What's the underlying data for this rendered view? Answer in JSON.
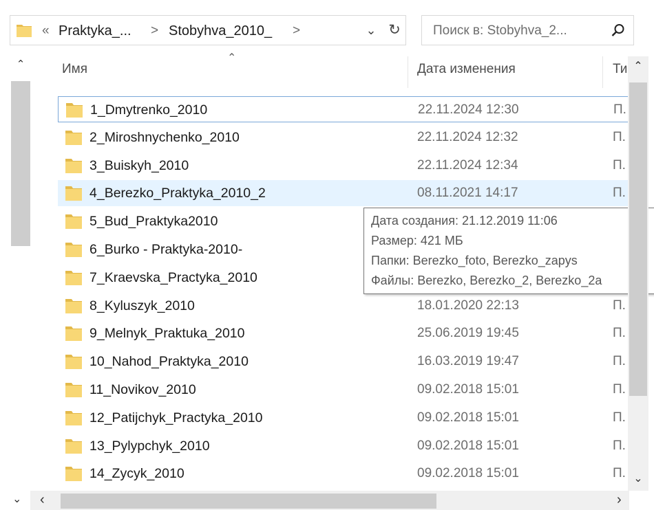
{
  "address": {
    "overflow": "«",
    "crumbs": [
      "Praktyka_...",
      "Stobyhva_2010_"
    ],
    "separators": [
      ">",
      ">",
      ">"
    ]
  },
  "search": {
    "placeholder": "Поиск в: Stobyhva_2..."
  },
  "columns": {
    "name": "Имя",
    "date": "Дата изменения",
    "type": "Ти"
  },
  "files": [
    {
      "name": "1_Dmytrenko_2010",
      "date": "22.11.2024 12:30",
      "type": "П."
    },
    {
      "name": "2_Miroshnychenko_2010",
      "date": "22.11.2024 12:32",
      "type": "П."
    },
    {
      "name": "3_Buiskyh_2010",
      "date": "22.11.2024 12:34",
      "type": "П."
    },
    {
      "name": "4_Berezko_Praktyka_2010_2",
      "date": "08.11.2021 14:17",
      "type": "П."
    },
    {
      "name": "5_Bud_Praktyka2010",
      "date": "",
      "type": ""
    },
    {
      "name": "6_Burko - Praktyka-2010-",
      "date": "",
      "type": ""
    },
    {
      "name": "7_Kraevska_Practyka_2010",
      "date": "",
      "type": ""
    },
    {
      "name": "8_Kyluszyk_2010",
      "date": "18.01.2020 22:13",
      "type": "П."
    },
    {
      "name": "9_Melnyk_Praktuka_2010",
      "date": "25.06.2019 19:45",
      "type": "П."
    },
    {
      "name": "10_Nahod_Praktyka_2010",
      "date": "16.03.2019 19:47",
      "type": "П."
    },
    {
      "name": "11_Novikov_2010",
      "date": "09.02.2018 15:01",
      "type": "П."
    },
    {
      "name": "12_Patijchyk_Practyka_2010",
      "date": "09.02.2018 15:01",
      "type": "П."
    },
    {
      "name": "13_Pylypchyk_2010",
      "date": "09.02.2018 15:01",
      "type": "П."
    },
    {
      "name": "14_Zycyk_2010",
      "date": "09.02.2018 15:01",
      "type": "П."
    }
  ],
  "tooltip": {
    "created": "Дата создания: 21.12.2019 11:06",
    "size": "Размер: 421 МБ",
    "folders": "Папки: Berezko_foto, Berezko_zapys",
    "files": "Файлы: Berezko, Berezko_2, Berezko_2a"
  },
  "colors": {
    "folder": "#f8d775",
    "folder_dark": "#e3b94a",
    "hover_row": "#e5f3ff",
    "focus_outline": "#7aa7d8"
  },
  "icons": {
    "folder": "folder-icon",
    "search": "search-icon",
    "refresh": "refresh-icon",
    "dropdown": "chevron-down-icon"
  }
}
